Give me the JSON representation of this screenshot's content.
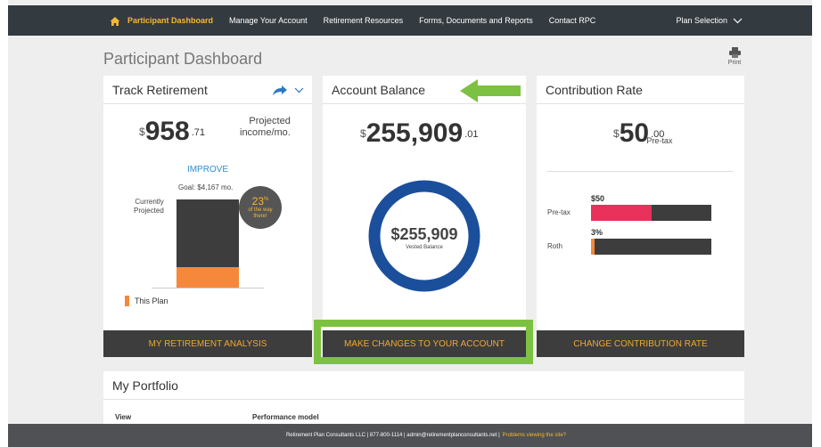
{
  "nav": {
    "items": [
      "Participant Dashboard",
      "Manage Your Account",
      "Retirement Resources",
      "Forms, Documents and Reports",
      "Contact RPC"
    ],
    "plan_selection": "Plan Selection"
  },
  "page": {
    "title": "Participant Dashboard",
    "print_label": "Print"
  },
  "track": {
    "title": "Track Retirement",
    "dollar": "$",
    "amount": "958",
    "cents": ".71",
    "projected_line1": "Projected",
    "projected_line2": "income/mo.",
    "improve": "IMPROVE",
    "goal": "Goal: $4,167 mo.",
    "currently": "Currently",
    "projected": "Projected",
    "progress_pct": "23",
    "pct_sign": "%",
    "of_way": "of the way",
    "there": "there!",
    "legend": "This Plan",
    "button": "MY RETIREMENT ANALYSIS"
  },
  "balance": {
    "title": "Account Balance",
    "dollar": "$",
    "amount": "255,909",
    "cents": ".01",
    "donut_value": "$255,909",
    "donut_label": "Vested Balance",
    "button": "MAKE CHANGES TO YOUR ACCOUNT"
  },
  "contribution": {
    "title": "Contribution Rate",
    "dollar": "$",
    "amount": "50",
    "cents": ".00",
    "pretax_small": "Pre-tax",
    "pretax_label": "Pre-tax",
    "pretax_value": "$50",
    "pretax_fill": 0.5,
    "roth_label": "Roth",
    "roth_value": "3%",
    "roth_fill": 0.03,
    "button": "CHANGE CONTRIBUTION RATE"
  },
  "portfolio": {
    "title": "My Portfolio",
    "view_label": "View",
    "perf_label": "Performance model"
  },
  "footer": {
    "text": "Retirement Plan Consultants LLC | 877-800-1114 | admin@retirementplanconsultants.net |",
    "link": "Problems viewing the site?"
  },
  "colors": {
    "nav_bg": "#333a40",
    "active": "#f7b733",
    "accent_orange": "#f5883a",
    "donut_blue": "#1b4f9c",
    "pretax_pink": "#e8315b",
    "highlight_green": "#7dc142"
  }
}
